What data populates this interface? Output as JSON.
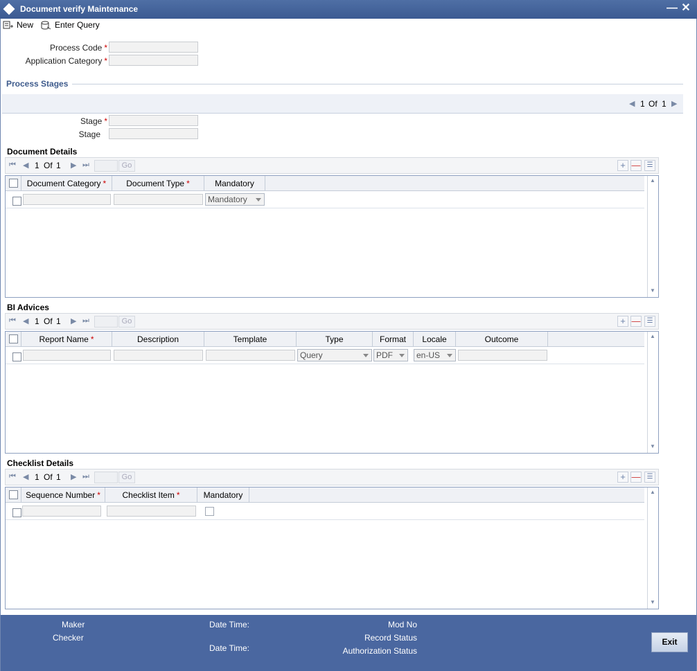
{
  "window": {
    "title": "Document verify Maintenance"
  },
  "toolbar": {
    "new_label": "New",
    "enter_query_label": "Enter Query"
  },
  "form": {
    "process_code_label": "Process Code",
    "application_category_label": "Application Category",
    "process_code_value": "",
    "application_category_value": ""
  },
  "process_stages": {
    "title": "Process Stages",
    "pager": {
      "current": "1",
      "of": "Of",
      "total": "1"
    },
    "stage_label": "Stage",
    "stage_desc_label": "Stage"
  },
  "document_details": {
    "title": "Document Details",
    "pager": {
      "current": "1",
      "of": "Of",
      "total": "1",
      "go": "Go"
    },
    "columns": [
      "Document Category",
      "Document Type",
      "Mandatory"
    ],
    "rows": [
      {
        "category": "",
        "type": "",
        "mandatory": "Mandatory"
      }
    ]
  },
  "bi_advices": {
    "title": "BI Advices",
    "pager": {
      "current": "1",
      "of": "Of",
      "total": "1",
      "go": "Go"
    },
    "columns": [
      "Report Name",
      "Description",
      "Template",
      "Type",
      "Format",
      "Locale",
      "Outcome"
    ],
    "rows": [
      {
        "report_name": "",
        "description": "",
        "template": "",
        "type": "Query",
        "format": "PDF",
        "locale": "en-US",
        "outcome": ""
      }
    ]
  },
  "checklist_details": {
    "title": "Checklist Details",
    "pager": {
      "current": "1",
      "of": "Of",
      "total": "1",
      "go": "Go"
    },
    "columns": [
      "Sequence Number",
      "Checklist Item",
      "Mandatory"
    ],
    "rows": [
      {
        "sequence": "",
        "item": ""
      }
    ]
  },
  "footer": {
    "maker_label": "Maker",
    "checker_label": "Checker",
    "datetime1_label": "Date Time:",
    "datetime2_label": "Date Time:",
    "mod_no_label": "Mod No",
    "record_status_label": "Record Status",
    "auth_status_label": "Authorization Status",
    "exit_label": "Exit"
  },
  "colors": {
    "titlebar": "#3b5a92",
    "footer": "#4a67a0",
    "section_title": "#3e5b8c",
    "required": "#cc0000"
  },
  "icons": [
    "diamond-icon",
    "minimize-icon",
    "close-icon",
    "new-icon",
    "enter-query-icon",
    "first-page-icon",
    "prev-page-icon",
    "next-page-icon",
    "last-page-icon",
    "add-row-icon",
    "delete-row-icon",
    "single-view-icon"
  ]
}
